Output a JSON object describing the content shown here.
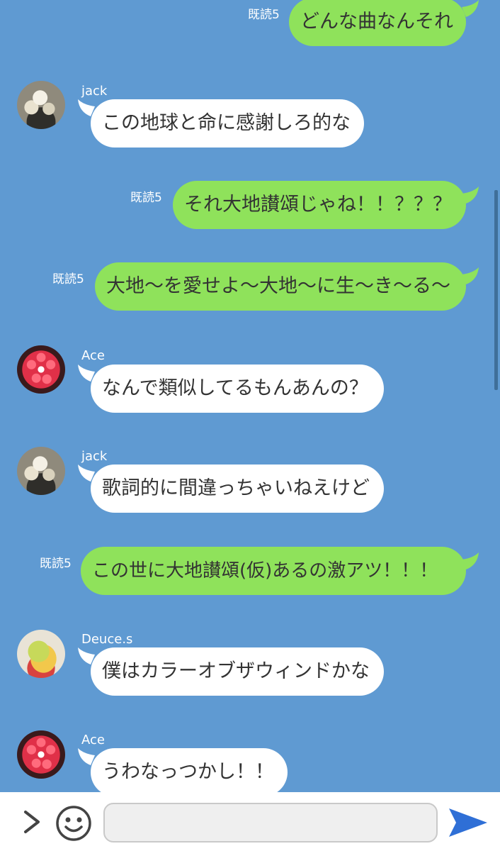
{
  "messages": [
    {
      "side": "out",
      "read": "既読5",
      "text": "どんな曲なんそれ"
    },
    {
      "side": "in",
      "name": "jack",
      "avatar": "avatar-jack",
      "text": "この地球と命に感謝しろ的な"
    },
    {
      "side": "out",
      "read": "既読5",
      "text": "それ大地讃頌じゃね！！？？？"
    },
    {
      "side": "out",
      "read": "既読5",
      "text": "大地〜を愛せよ〜大地〜に生〜き〜る〜"
    },
    {
      "side": "in",
      "name": "Ace",
      "avatar": "avatar-ace",
      "text": "なんで類似してるもんあんの？"
    },
    {
      "side": "in",
      "name": "jack",
      "avatar": "avatar-jack",
      "text": "歌詞的に間違っちゃいねえけど"
    },
    {
      "side": "out",
      "read": "既読5",
      "text": "この世に大地讃頌(仮)あるの激アツ！！！"
    },
    {
      "side": "in",
      "name": "Deuce.s",
      "avatar": "avatar-deuce",
      "text": "僕はカラーオブザウィンドかな"
    },
    {
      "side": "in",
      "name": "Ace",
      "avatar": "avatar-ace",
      "text": "うわなっつかし！！"
    }
  ],
  "input": {
    "value": "",
    "placeholder": ""
  },
  "icons": {
    "expand": "chevron-right-icon",
    "emoji": "smiley-icon",
    "send": "send-arrow-icon"
  },
  "colors": {
    "background": "#5f9ad2",
    "outgoing_bubble": "#8fe25b",
    "incoming_bubble": "#ffffff",
    "send_icon": "#2f6fd6"
  }
}
